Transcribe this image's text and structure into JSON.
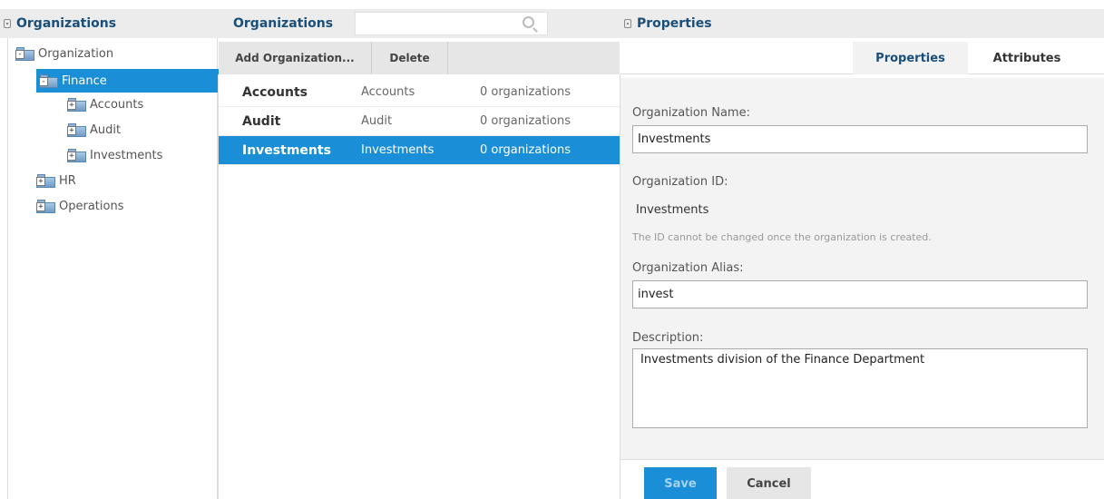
{
  "left_panel": {
    "title": "Organizations",
    "tree": [
      {
        "label": "Organization",
        "expanded": true,
        "level": 0
      },
      {
        "label": "Finance",
        "expanded": true,
        "level": 1,
        "selected": true
      },
      {
        "label": "Accounts",
        "expanded": false,
        "level": 2
      },
      {
        "label": "Audit",
        "expanded": false,
        "level": 2
      },
      {
        "label": "Investments",
        "expanded": false,
        "level": 2
      },
      {
        "label": "HR",
        "expanded": false,
        "level": 1
      },
      {
        "label": "Operations",
        "expanded": false,
        "level": 1
      }
    ]
  },
  "middle_panel": {
    "title": "Organizations",
    "search": {
      "value": "",
      "placeholder": ""
    },
    "toolbar": {
      "add_label": "Add Organization...",
      "delete_label": "Delete"
    },
    "rows": [
      {
        "name": "Accounts",
        "id": "Accounts",
        "count": "0 organizations",
        "selected": false
      },
      {
        "name": "Audit",
        "id": "Audit",
        "count": "0 organizations",
        "selected": false
      },
      {
        "name": "Investments",
        "id": "Investments",
        "count": "0 organizations",
        "selected": true
      }
    ]
  },
  "right_panel": {
    "title": "Properties",
    "tabs": [
      {
        "label": "Properties",
        "active": true
      },
      {
        "label": "Attributes",
        "active": false
      }
    ],
    "form": {
      "name_label": "Organization Name:",
      "name_value": "Investments",
      "id_label": "Organization ID:",
      "id_value": "Investments",
      "id_hint": "The ID cannot be changed once the organization is created.",
      "alias_label": "Organization Alias:",
      "alias_value": "invest",
      "description_label": "Description:",
      "description_value": "Investments division of the Finance Department"
    },
    "buttons": {
      "save_label": "Save",
      "cancel_label": "Cancel"
    }
  },
  "colors": {
    "accent": "#1a8fd8",
    "header_text": "#1a4f7a",
    "header_bg": "#ececec"
  }
}
